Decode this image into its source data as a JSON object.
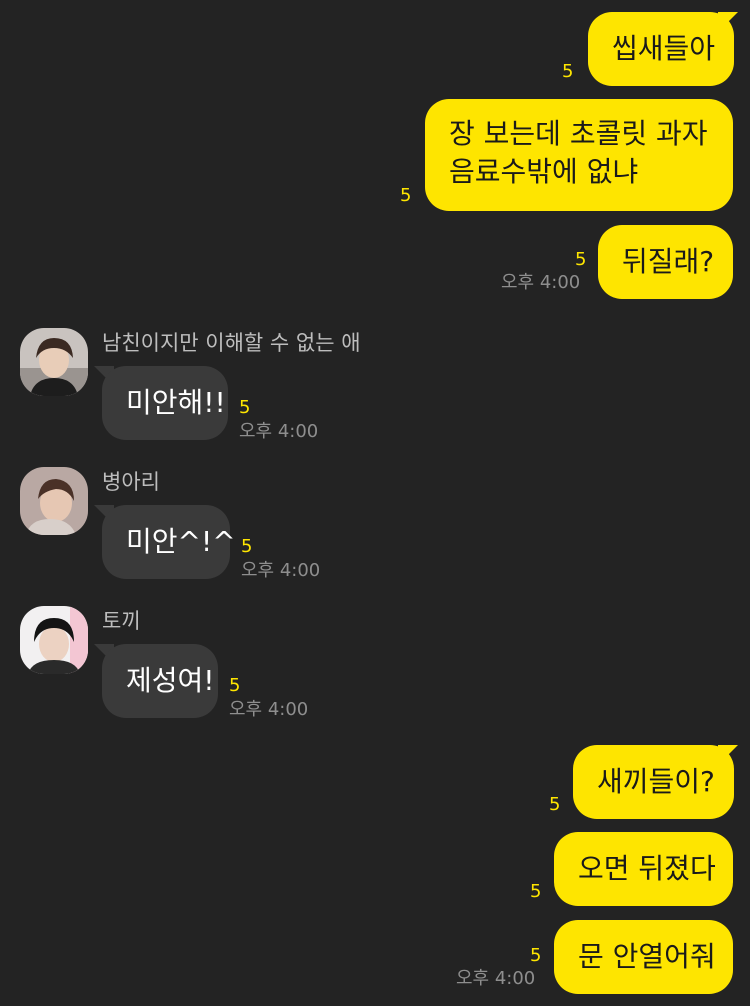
{
  "colors": {
    "background": "#232323",
    "my_bubble": "#FEE500",
    "other_bubble": "#3a3a3a",
    "unread": "#FEE500"
  },
  "messages_sent_top": [
    {
      "text": "씹새들아",
      "unread": "5"
    },
    {
      "text_line1": "장 보는데 초콜릿 과자",
      "text_line2": "음료수밖에 없냐",
      "unread": "5"
    },
    {
      "text": "뒤질래?",
      "unread": "5",
      "time": "오후 4:00"
    }
  ],
  "messages_received": [
    {
      "sender": "남친이지만 이해할 수 없는 애",
      "text": "미안해!!",
      "unread": "5",
      "time": "오후 4:00",
      "avatar_icon": "profile-photo"
    },
    {
      "sender": "병아리",
      "text": "미안^!^",
      "unread": "5",
      "time": "오후 4:00",
      "avatar_icon": "profile-photo"
    },
    {
      "sender": "토끼",
      "text": "제성여!",
      "unread": "5",
      "time": "오후 4:00",
      "avatar_icon": "profile-photo"
    }
  ],
  "messages_sent_bottom": [
    {
      "text": "새끼들이?",
      "unread": "5"
    },
    {
      "text": "오면 뒤졌다",
      "unread": "5"
    },
    {
      "text": "문 안열어줘",
      "unread": "5",
      "time": "오후 4:00"
    }
  ]
}
